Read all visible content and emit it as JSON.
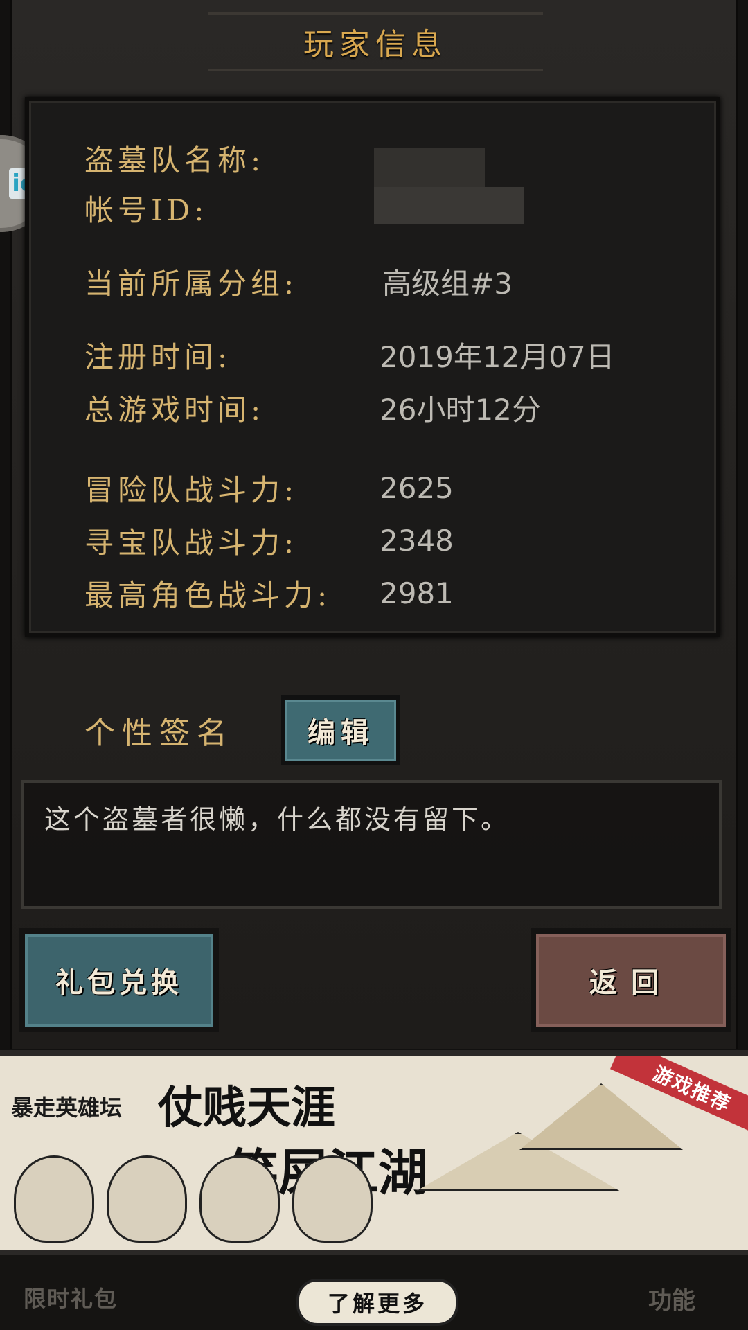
{
  "header": {
    "title": "玩家信息"
  },
  "side_tab": {
    "label": "ie"
  },
  "player_info": {
    "rows": [
      {
        "label": "盗墓队名称:",
        "value": ""
      },
      {
        "label": "帐号ID:",
        "value": ""
      },
      {
        "label": "当前所属分组:",
        "value": "高级组#3"
      },
      {
        "label": "注册时间:",
        "value": "2019年12月07日"
      },
      {
        "label": "总游戏时间:",
        "value": "26小时12分"
      },
      {
        "label": "冒险队战斗力:",
        "value": "2625"
      },
      {
        "label": "寻宝队战斗力:",
        "value": "2348"
      },
      {
        "label": "最高角色战斗力:",
        "value": "2981"
      }
    ]
  },
  "signature": {
    "label": "个性签名",
    "edit_button": "编辑",
    "text": "这个盗墓者很懒，什么都没有留下。"
  },
  "buttons": {
    "gift_redeem": "礼包兑换",
    "back": "返回"
  },
  "banner": {
    "brand": "暴走英雄坛",
    "line1": "仗贱天涯",
    "line2": "笑屎江湖",
    "ribbon": "游戏推荐",
    "learn_more": "了解更多"
  },
  "bottom_bar": {
    "left_label": "限时礼包",
    "right_label": "功能"
  }
}
